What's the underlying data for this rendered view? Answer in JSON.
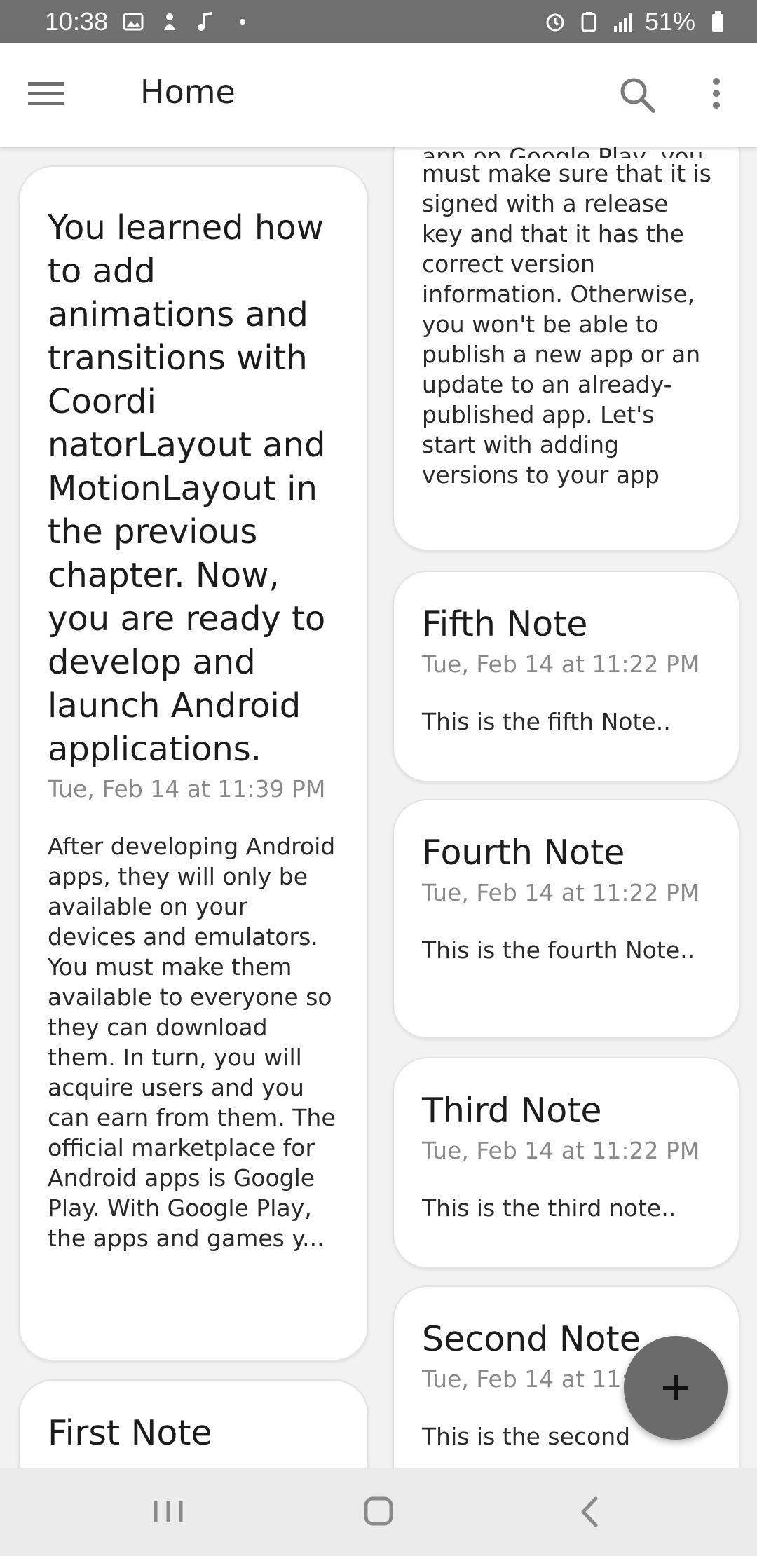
{
  "status_bar": {
    "time": "10:38",
    "battery": "51%"
  },
  "app_bar": {
    "title": "Home",
    "icons": [
      "menu-icon",
      "search-icon",
      "more-vert-icon"
    ]
  },
  "notes_left": [
    {
      "title": "You learned how to add animations and transitions with Coordi natorLayout and MotionLayout in the previous chapter. Now, you are ready to develop and launch Android applications.",
      "date": "Tue, Feb 14 at 11:39 PM",
      "body": "After developing Android apps, they will only be available on your devices and emulators. You must make them available to everyone so they can download them. In turn, you will acquire users and you can earn from them. The official marketplace for Android apps is Google Play. With Google Play, the apps and games y..."
    },
    {
      "title": "First Note"
    }
  ],
  "notes_right": [
    {
      "body": "must make sure that it is signed with a release key and that it has the correct version information. Otherwise, you won't be able to publish a new app or an update to an already-published app. Let's start with adding versions to your app"
    },
    {
      "title": "Fifth Note",
      "date": "Tue, Feb 14 at 11:22 PM",
      "body": "This is the fifth Note.."
    },
    {
      "title": "Fourth Note",
      "date": "Tue, Feb 14 at 11:22 PM",
      "body": "This is the fourth Note.."
    },
    {
      "title": "Third Note",
      "date": "Tue, Feb 14 at 11:22 PM",
      "body": "This is the third note.."
    },
    {
      "title": "Second Note",
      "date": "Tue, Feb 14 at 11:",
      "body": "This is the second"
    }
  ],
  "fab": {
    "icon": "add-icon"
  },
  "nav_bar": {
    "icons": [
      "recents-icon",
      "home-icon",
      "back-icon"
    ]
  },
  "colors": {
    "status_bar": "#6f6f6f",
    "fab": "#6b6b6b",
    "background": "#f2f2f2"
  }
}
